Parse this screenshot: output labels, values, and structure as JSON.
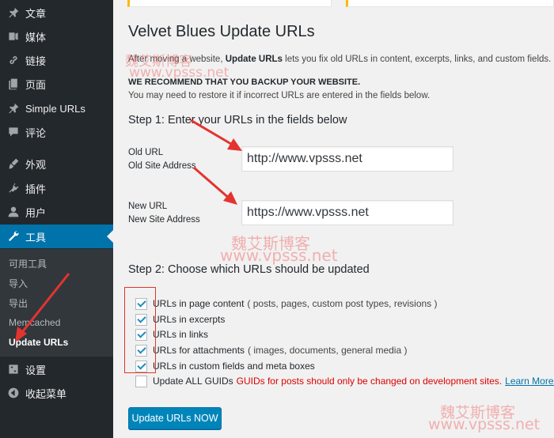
{
  "sidebar": {
    "items": [
      {
        "label": "文章",
        "icon": "pushpin-icon"
      },
      {
        "label": "媒体",
        "icon": "media-icon"
      },
      {
        "label": "链接",
        "icon": "link-icon"
      },
      {
        "label": "页面",
        "icon": "page-icon"
      },
      {
        "label": "Simple URLs",
        "icon": "pushpin-icon"
      },
      {
        "label": "评论",
        "icon": "comment-icon"
      },
      {
        "label": "外观",
        "icon": "brush-icon"
      },
      {
        "label": "插件",
        "icon": "plugin-icon"
      },
      {
        "label": "用户",
        "icon": "user-icon"
      },
      {
        "label": "工具",
        "icon": "wrench-icon"
      }
    ],
    "submenu": [
      "可用工具",
      "导入",
      "导出",
      "Memcached",
      "Update URLs"
    ],
    "bottom_items": [
      {
        "label": "设置",
        "icon": "settings-icon"
      },
      {
        "label": "收起菜单",
        "icon": "collapse-icon"
      }
    ]
  },
  "main": {
    "title": "Velvet Blues Update URLs",
    "intro_prefix": "After moving a website, ",
    "intro_bold": "Update URLs",
    "intro_suffix": " lets you fix old URLs in content, excerpts, links, and custom fields.",
    "warning_bold": "WE RECOMMEND THAT YOU BACKUP YOUR WEBSITE.",
    "warning_text": "You may need to restore it if incorrect URLs are entered in the fields below.",
    "step1_title": "Step 1: Enter your URLs in the fields below",
    "old_url_label": "Old URL",
    "old_url_sub": "Old Site Address",
    "old_url_value": "http://www.vpsss.net",
    "new_url_label": "New URL",
    "new_url_sub": "New Site Address",
    "new_url_value": "https://www.vpsss.net",
    "step2_title": "Step 2: Choose which URLs should be updated",
    "options": [
      {
        "label": "URLs in page content",
        "hint": "( posts, pages, custom post types, revisions )",
        "checked": true
      },
      {
        "label": "URLs in excerpts",
        "hint": "",
        "checked": true
      },
      {
        "label": "URLs in links",
        "hint": "",
        "checked": true
      },
      {
        "label": "URLs for attachments",
        "hint": "( images, documents, general media )",
        "checked": true
      },
      {
        "label": "URLs in custom fields and meta boxes",
        "hint": "",
        "checked": true
      }
    ],
    "guid_label": "Update ALL GUIDs",
    "guid_warning": "GUIDs for posts should only be changed on development sites.",
    "guid_link": "Learn More.",
    "submit_label": "Update URLs NOW"
  },
  "watermarks": {
    "cn": "魏艾斯博客",
    "url": "www.vpsss.net"
  },
  "colors": {
    "sidebar_bg": "#23282d",
    "active_bg": "#0073aa",
    "button_bg": "#0085ba",
    "warning_red": "#dd0000",
    "annotation_red": "#e3342f"
  }
}
